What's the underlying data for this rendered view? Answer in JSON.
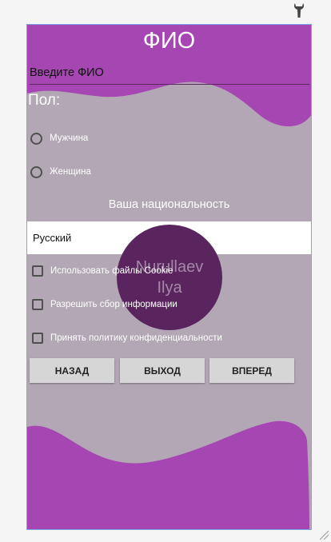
{
  "toolbar": {
    "wrench_icon": "wrench-icon"
  },
  "form": {
    "title": "ФИО",
    "name_placeholder": "Введите ФИО",
    "gender_label": "Пол:",
    "gender_options": [
      "Мужчина",
      "Женщина"
    ],
    "nationality_label": "Ваша национальность",
    "nationality_value": "Русский",
    "checkboxes": [
      "Использовать файлы Cookie",
      "Разрешить сбор информации",
      "Принять политику конфиденциальности"
    ],
    "buttons": {
      "back": "НАЗАД",
      "exit": "ВЫХОД",
      "next": "ВПЕРЕД"
    }
  },
  "watermark": {
    "line1": "Nurullaev",
    "line2": "Ilya"
  },
  "colors": {
    "purple": "#a646b2",
    "background": "#b3a7b5",
    "circle": "#5a245e",
    "button": "#d6d6d6"
  }
}
